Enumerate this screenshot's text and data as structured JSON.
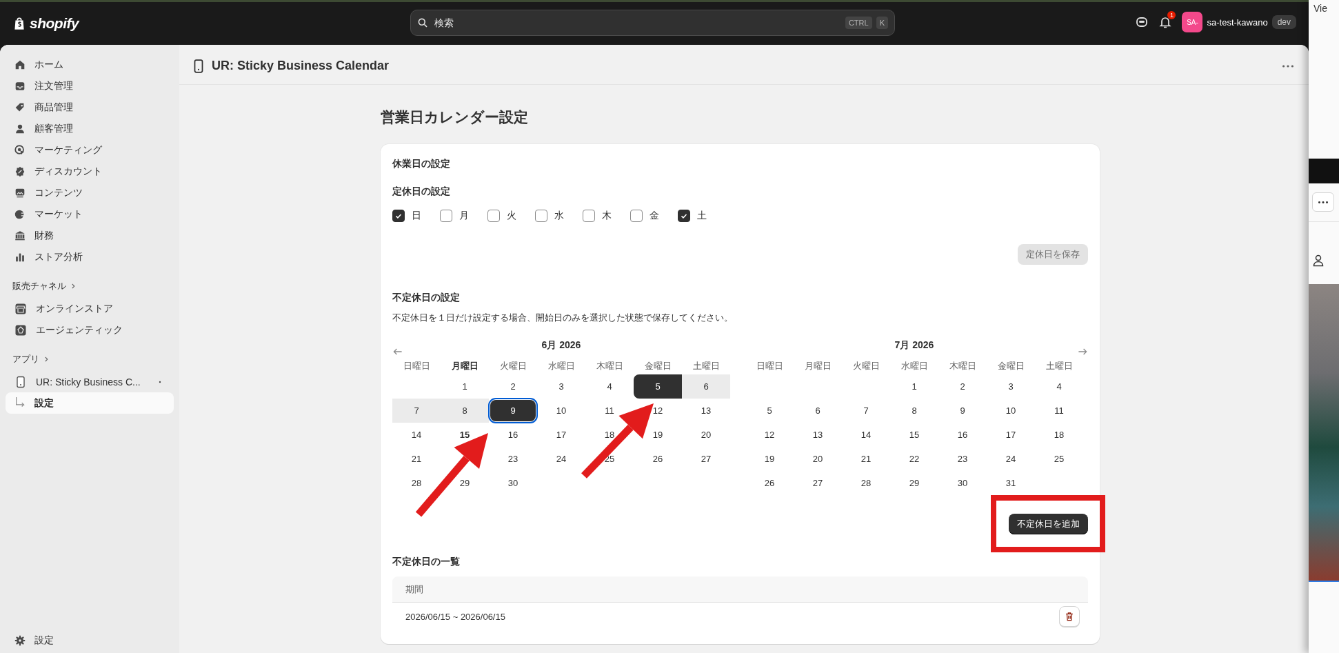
{
  "topbar": {
    "logo_text": "shopify",
    "search": {
      "placeholder": "検索",
      "shortcut": [
        "CTRL",
        "K"
      ]
    },
    "notification_count": "1",
    "user": {
      "initials": "SA-",
      "name": "sa-test-kawano",
      "badge": "dev"
    }
  },
  "sidebar": {
    "items": [
      {
        "label": "ホーム",
        "selected": false
      },
      {
        "label": "注文管理",
        "selected": false
      },
      {
        "label": "商品管理",
        "selected": false
      },
      {
        "label": "顧客管理",
        "selected": false
      },
      {
        "label": "マーケティング",
        "selected": false
      },
      {
        "label": "ディスカウント",
        "selected": false
      },
      {
        "label": "コンテンツ",
        "selected": false
      },
      {
        "label": "マーケット",
        "selected": false
      },
      {
        "label": "財務",
        "selected": false
      },
      {
        "label": "ストア分析",
        "selected": false
      }
    ],
    "sections": [
      {
        "title": "販売チャネル",
        "items": [
          {
            "label": "オンラインストア",
            "selected": false
          },
          {
            "label": "エージェンティック",
            "selected": false
          }
        ]
      },
      {
        "title": "アプリ",
        "items": [
          {
            "label": "UR: Sticky Business C...",
            "selected": false,
            "children": [
              {
                "label": "設定",
                "selected": true
              }
            ]
          }
        ]
      }
    ],
    "footer": {
      "label": "設定"
    }
  },
  "page_header": {
    "title": "UR: Sticky Business Calendar"
  },
  "page": {
    "title": "営業日カレンダー設定",
    "card": {
      "title": "休業日の設定",
      "regular": {
        "title": "定休日の設定",
        "days": [
          {
            "label": "日",
            "checked": true
          },
          {
            "label": "月",
            "checked": false
          },
          {
            "label": "火",
            "checked": false
          },
          {
            "label": "水",
            "checked": false
          },
          {
            "label": "木",
            "checked": false
          },
          {
            "label": "金",
            "checked": false
          },
          {
            "label": "土",
            "checked": true
          }
        ],
        "save_button": {
          "label": "定休日を保存",
          "disabled": true
        }
      },
      "irregular": {
        "title": "不定休日の設定",
        "note": "不定休日を１日だけ設定する場合、開始日のみを選択した状態で保存してください。",
        "months": [
          {
            "title": "6月 2026",
            "weekdays": [
              {
                "label": "日曜日",
                "today": false
              },
              {
                "label": "月曜日",
                "today": true
              },
              {
                "label": "火曜日",
                "today": false
              },
              {
                "label": "水曜日",
                "today": false
              },
              {
                "label": "木曜日",
                "today": false
              },
              {
                "label": "金曜日",
                "today": false
              },
              {
                "label": "土曜日",
                "today": false
              }
            ],
            "weeks": [
              [
                {
                  "label": "1",
                  "selected": false,
                  "in_range": false,
                  "today": false
                },
                {
                  "label": "2",
                  "selected": false,
                  "in_range": false,
                  "today": false
                },
                {
                  "label": "3",
                  "selected": false,
                  "in_range": false,
                  "today": false
                },
                {
                  "label": "4",
                  "selected": false,
                  "in_range": false,
                  "today": false
                },
                {
                  "label": "5",
                  "selected": true,
                  "in_range": false,
                  "today": false
                },
                {
                  "label": "6",
                  "selected": false,
                  "in_range": true,
                  "today": false
                }
              ],
              [
                {
                  "label": "7",
                  "selected": false,
                  "in_range": true,
                  "today": false
                },
                {
                  "label": "8",
                  "selected": false,
                  "in_range": true,
                  "today": false
                },
                {
                  "label": "9",
                  "selected": true,
                  "in_range": false,
                  "today": false
                },
                {
                  "label": "10",
                  "selected": false,
                  "in_range": false,
                  "today": false
                },
                {
                  "label": "11",
                  "selected": false,
                  "in_range": false,
                  "today": false
                },
                {
                  "label": "12",
                  "selected": false,
                  "in_range": false,
                  "today": false
                },
                {
                  "label": "13",
                  "selected": false,
                  "in_range": false,
                  "today": false
                }
              ],
              [
                {
                  "label": "14",
                  "selected": false,
                  "in_range": false,
                  "today": false
                },
                {
                  "label": "15",
                  "selected": false,
                  "in_range": false,
                  "today": true
                },
                {
                  "label": "16",
                  "selected": false,
                  "in_range": false,
                  "today": false
                },
                {
                  "label": "17",
                  "selected": false,
                  "in_range": false,
                  "today": false
                },
                {
                  "label": "18",
                  "selected": false,
                  "in_range": false,
                  "today": false
                },
                {
                  "label": "19",
                  "selected": false,
                  "in_range": false,
                  "today": false
                },
                {
                  "label": "20",
                  "selected": false,
                  "in_range": false,
                  "today": false
                }
              ],
              [
                {
                  "label": "21",
                  "selected": false,
                  "in_range": false,
                  "today": false
                },
                {
                  "covered": true
                },
                {
                  "label": "23",
                  "selected": false,
                  "in_range": false,
                  "today": false
                },
                {
                  "label": "24",
                  "selected": false,
                  "in_range": false,
                  "today": false
                },
                {
                  "label": "25",
                  "selected": false,
                  "in_range": false,
                  "today": false
                },
                {
                  "label": "26",
                  "selected": false,
                  "in_range": false,
                  "today": false
                },
                {
                  "label": "27",
                  "selected": false,
                  "in_range": false,
                  "today": false
                }
              ],
              [
                {
                  "label": "28",
                  "selected": false,
                  "in_range": false,
                  "today": false
                },
                {
                  "label": "29",
                  "selected": false,
                  "in_range": false,
                  "today": false
                },
                {
                  "label": "30",
                  "selected": false,
                  "in_range": false,
                  "today": false
                }
              ]
            ]
          },
          {
            "title": "7月 2026",
            "weekdays": [
              {
                "label": "日曜日",
                "today": false
              },
              {
                "label": "月曜日",
                "today": false
              },
              {
                "label": "火曜日",
                "today": false
              },
              {
                "label": "水曜日",
                "today": false
              },
              {
                "label": "木曜日",
                "today": false
              },
              {
                "label": "金曜日",
                "today": false
              },
              {
                "label": "土曜日",
                "today": false
              }
            ],
            "weeks": [
              [
                {
                  "label": "1",
                  "selected": false,
                  "in_range": false,
                  "today": false
                },
                {
                  "label": "2",
                  "selected": false,
                  "in_range": false,
                  "today": false
                },
                {
                  "label": "3",
                  "selected": false,
                  "in_range": false,
                  "today": false
                },
                {
                  "label": "4",
                  "selected": false,
                  "in_range": false,
                  "today": false
                }
              ],
              [
                {
                  "label": "5",
                  "selected": false,
                  "in_range": false,
                  "today": false
                },
                {
                  "label": "6",
                  "selected": false,
                  "in_range": false,
                  "today": false
                },
                {
                  "label": "7",
                  "selected": false,
                  "in_range": false,
                  "today": false
                },
                {
                  "label": "8",
                  "selected": false,
                  "in_range": false,
                  "today": false
                },
                {
                  "label": "9",
                  "selected": false,
                  "in_range": false,
                  "today": false
                },
                {
                  "label": "10",
                  "selected": false,
                  "in_range": false,
                  "today": false
                },
                {
                  "label": "11",
                  "selected": false,
                  "in_range": false,
                  "today": false
                }
              ],
              [
                {
                  "label": "12",
                  "selected": false,
                  "in_range": false,
                  "today": false
                },
                {
                  "label": "13",
                  "selected": false,
                  "in_range": false,
                  "today": false
                },
                {
                  "label": "14",
                  "selected": false,
                  "in_range": false,
                  "today": false
                },
                {
                  "label": "15",
                  "selected": false,
                  "in_range": false,
                  "today": false
                },
                {
                  "label": "16",
                  "selected": false,
                  "in_range": false,
                  "today": false
                },
                {
                  "label": "17",
                  "selected": false,
                  "in_range": false,
                  "today": false
                },
                {
                  "label": "18",
                  "selected": false,
                  "in_range": false,
                  "today": false
                }
              ],
              [
                {
                  "label": "19",
                  "selected": false,
                  "in_range": false,
                  "today": false
                },
                {
                  "label": "20",
                  "selected": false,
                  "in_range": false,
                  "today": false
                },
                {
                  "label": "21",
                  "selected": false,
                  "in_range": false,
                  "today": false
                },
                {
                  "label": "22",
                  "selected": false,
                  "in_range": false,
                  "today": false
                },
                {
                  "label": "23",
                  "selected": false,
                  "in_range": false,
                  "today": false
                },
                {
                  "label": "24",
                  "selected": false,
                  "in_range": false,
                  "today": false
                },
                {
                  "label": "25",
                  "selected": false,
                  "in_range": false,
                  "today": false
                }
              ],
              [
                {
                  "label": "26",
                  "selected": false,
                  "in_range": false,
                  "today": false
                },
                {
                  "label": "27",
                  "selected": false,
                  "in_range": false,
                  "today": false
                },
                {
                  "label": "28",
                  "selected": false,
                  "in_range": false,
                  "today": false
                },
                {
                  "label": "29",
                  "selected": false,
                  "in_range": false,
                  "today": false
                },
                {
                  "label": "30",
                  "selected": false,
                  "in_range": false,
                  "today": false
                },
                {
                  "label": "31",
                  "selected": false,
                  "in_range": false,
                  "today": false
                }
              ]
            ]
          }
        ],
        "add_button": "不定休日を追加"
      },
      "list": {
        "title": "不定休日の一覧",
        "columns": [
          "期間"
        ],
        "rows": [
          {
            "period": "2026/06/15 ~ 2026/06/15"
          }
        ]
      }
    }
  },
  "side_window": {
    "top_text": "Vie"
  },
  "annotations": [
    {
      "kind": "arrow"
    },
    {
      "kind": "arrow"
    },
    {
      "kind": "frame"
    }
  ]
}
